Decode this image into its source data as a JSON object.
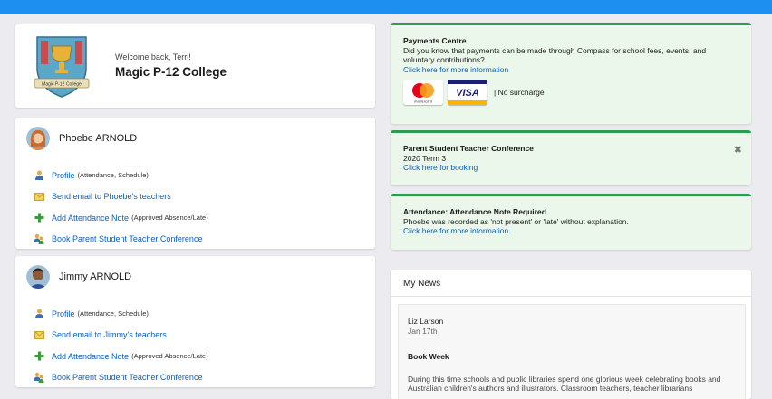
{
  "welcome": {
    "greeting": "Welcome back, Terri!",
    "school_name": "Magic P-12 College",
    "crest_banner": "Magic P-12 College"
  },
  "students": [
    {
      "name": "Phoebe ARNOLD",
      "links": [
        {
          "label": "Profile",
          "note": "(Attendance, Schedule)",
          "icon": "person-icon"
        },
        {
          "label": "Send email to Phoebe's teachers",
          "note": "",
          "icon": "envelope-icon"
        },
        {
          "label": "Add Attendance Note",
          "note": "(Approved Absence/Late)",
          "icon": "plus-icon"
        },
        {
          "label": "Book Parent Student Teacher Conference",
          "note": "",
          "icon": "conference-icon"
        }
      ]
    },
    {
      "name": "Jimmy ARNOLD",
      "links": [
        {
          "label": "Profile",
          "note": "(Attendance, Schedule)",
          "icon": "person-icon"
        },
        {
          "label": "Send email to Jimmy's teachers",
          "note": "",
          "icon": "envelope-icon"
        },
        {
          "label": "Add Attendance Note",
          "note": "(Approved Absence/Late)",
          "icon": "plus-icon"
        },
        {
          "label": "Book Parent Student Teacher Conference",
          "note": "",
          "icon": "conference-icon"
        }
      ]
    }
  ],
  "payments": {
    "title": "Payments Centre",
    "text": "Did you know that payments can be made through Compass for school fees, events, and voluntary contributions?",
    "link": "Click here for more information",
    "mastercard_label": "mastercard",
    "visa_label": "VISA",
    "surcharge": "|  No surcharge"
  },
  "conference": {
    "title": "Parent Student Teacher Conference",
    "text": "2020 Term 3",
    "link": "Click here for booking",
    "close": "✖"
  },
  "attendance": {
    "title": "Attendance: Attendance Note Required",
    "text": "Phoebe was recorded as 'not present' or 'late' without explanation.",
    "link": "Click here for more information"
  },
  "news": {
    "heading": "My News",
    "author": "Liz Larson",
    "date": "Jan 17th",
    "title": "Book Week",
    "text": "During this time schools and public libraries spend one glorious week celebrating books and Australian children's authors and illustrators. Classroom teachers, teacher librarians"
  },
  "colors": {
    "top_bar": "#1c8ff0",
    "link": "#0d5fbd",
    "notice_bg": "#eaf7ea",
    "notice_border": "#2e9c4a"
  }
}
